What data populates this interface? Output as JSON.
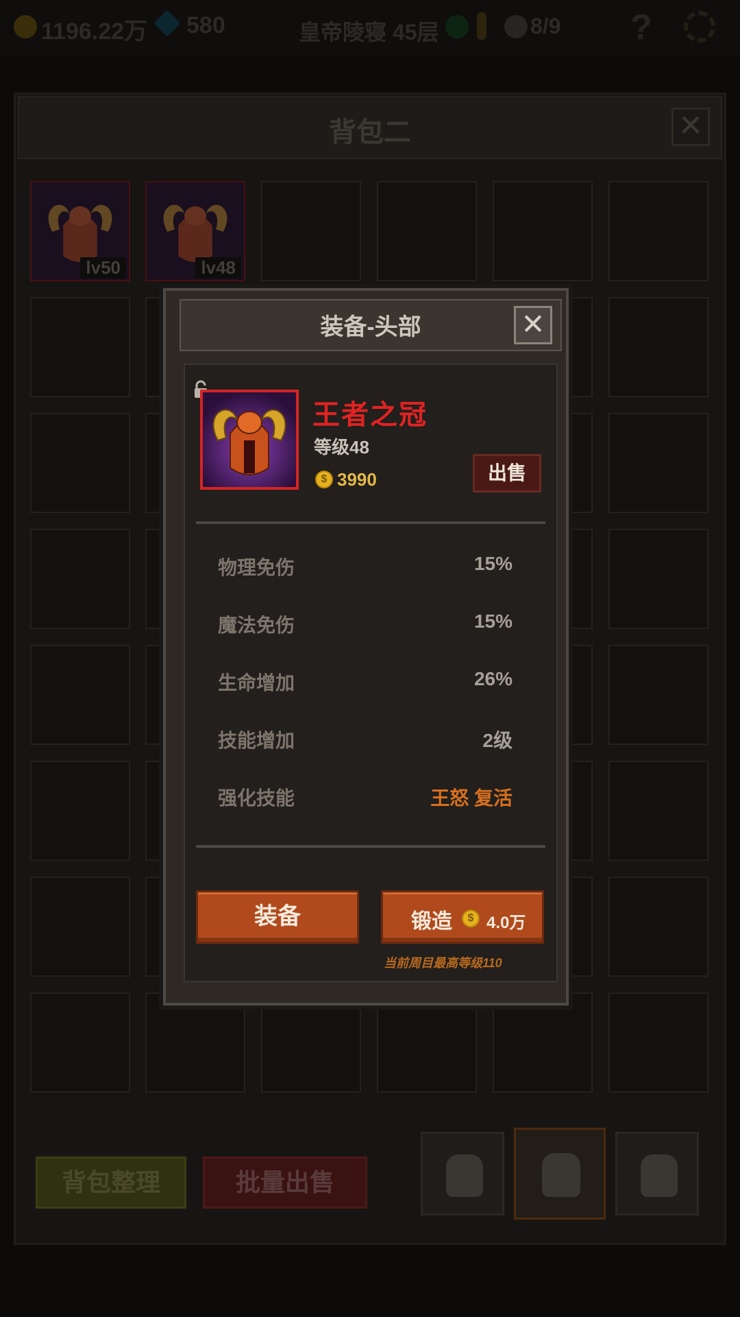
{
  "top_bar": {
    "gold": "1196.22万",
    "gems": "580",
    "location": "皇帝陵寝 45层",
    "kills": "8/9"
  },
  "bag": {
    "title": "背包二",
    "slots": [
      {
        "level": "lv50"
      },
      {
        "level": "lv48"
      }
    ],
    "sort_button": "背包整理",
    "bulk_sell_button": "批量出售"
  },
  "modal": {
    "title": "装备-头部",
    "item": {
      "name": "王者之冠",
      "level": "等级48",
      "price": "3990",
      "sell_button": "出售"
    },
    "stats": [
      {
        "label": "物理免伤",
        "value": "15%"
      },
      {
        "label": "魔法免伤",
        "value": "15%"
      },
      {
        "label": "生命增加",
        "value": "26%"
      },
      {
        "label": "技能增加",
        "value": "2级"
      },
      {
        "label": "强化技能",
        "value": "王怒 复活"
      }
    ],
    "equip_button": "装备",
    "forge_button": "锻造",
    "forge_cost": "4.0万",
    "max_level_note": "当前周目最高等级110"
  },
  "colors": {
    "item_name": "#e02323",
    "skill_text": "#d8701f",
    "button_orange": "#b04a1d",
    "frame_red": "#d42424"
  },
  "icons": [
    "gold-coin-icon",
    "gem-icon",
    "shield-icon",
    "key-icon",
    "skull-icon",
    "help-icon",
    "settings-icon",
    "close-icon",
    "lock-icon",
    "backpack-icon",
    "horned-helmet-icon"
  ]
}
